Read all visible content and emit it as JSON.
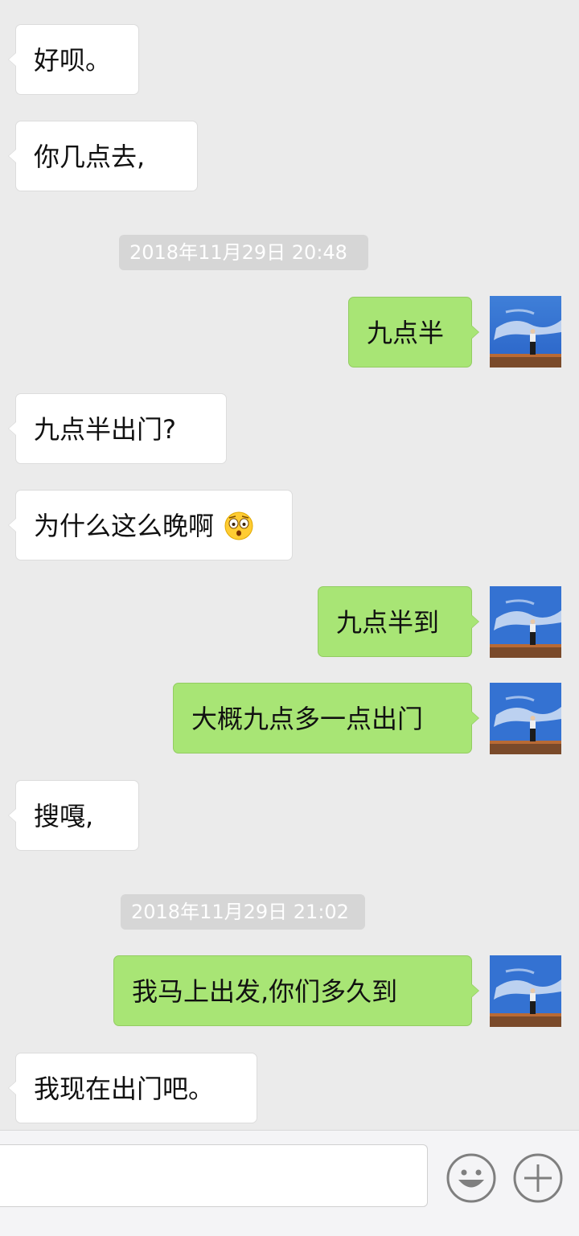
{
  "conversation": {
    "messages": [
      {
        "side": "in",
        "text": "好呗。"
      },
      {
        "side": "in",
        "text": "你几点去,"
      },
      {
        "side": "out",
        "text": "九点半"
      },
      {
        "side": "in",
        "text": "九点半出门?"
      },
      {
        "side": "in",
        "text": "为什么这么晚啊",
        "emoji": "astonished-face-emoji"
      },
      {
        "side": "out",
        "text": "九点半到"
      },
      {
        "side": "out",
        "text": "大概九点多一点出门"
      },
      {
        "side": "in",
        "text": "搜嘎,"
      },
      {
        "side": "out",
        "text": "我马上出发,你们多久到"
      },
      {
        "side": "in",
        "text": "我现在出门吧。"
      }
    ],
    "timestamps": [
      "2018年11月29日 20:48",
      "2018年11月29日 21:02"
    ]
  },
  "input_bar": {
    "emoji_icon": "smiley-face-icon",
    "more_icon": "plus-circle-icon"
  },
  "colors": {
    "background": "#ebebeb",
    "incoming_bubble": "#ffffff",
    "outgoing_bubble": "#a8e575",
    "timestamp_pill": "#d6d6d6"
  }
}
